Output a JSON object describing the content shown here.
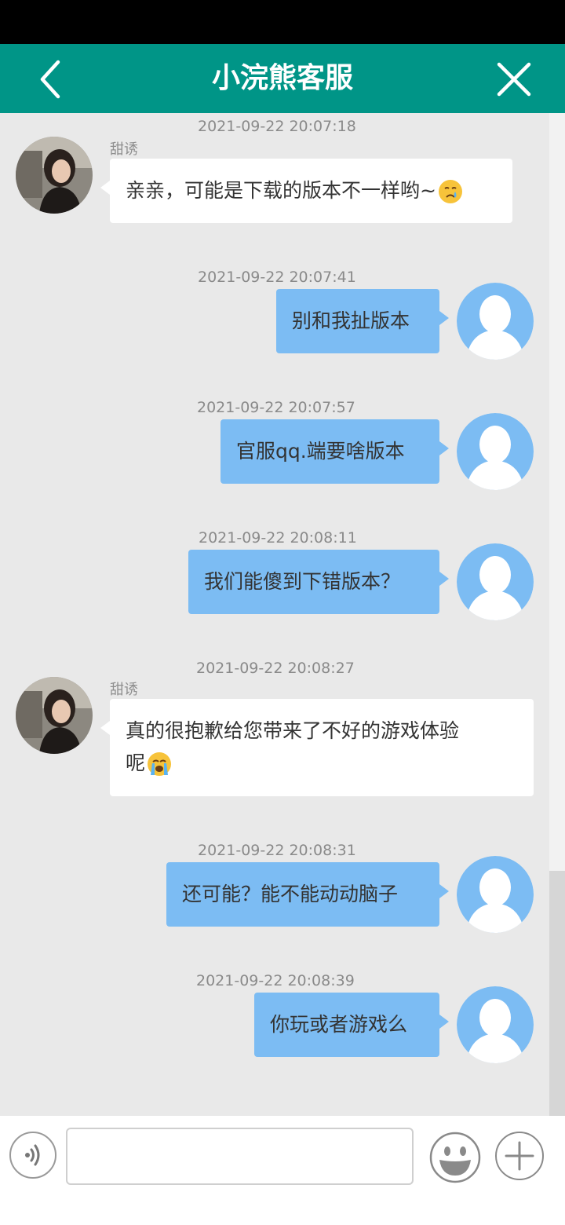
{
  "header": {
    "title": "小浣熊客服",
    "back_icon": "chevron-left-icon",
    "close_icon": "close-icon",
    "bg_color": "#009587"
  },
  "messages": [
    {
      "direction": "in",
      "sender": "甜诱",
      "time": "2021-09-22 20:07:18",
      "text": "亲亲，可能是下载的版本不一样哟~",
      "emoji": "crying-face-icon"
    },
    {
      "direction": "out",
      "time": "2021-09-22 20:07:41",
      "text": "别和我扯版本"
    },
    {
      "direction": "out",
      "time": "2021-09-22 20:07:57",
      "text": "官服qq.端要啥版本"
    },
    {
      "direction": "out",
      "time": "2021-09-22 20:08:11",
      "text": "我们能傻到下错版本？"
    },
    {
      "direction": "in",
      "sender": "甜诱",
      "time": "2021-09-22 20:08:27",
      "text_line1": "真的很抱歉给您带来了不好的游戏体验",
      "text_line2": "呢",
      "emoji": "loudly-crying-face-icon"
    },
    {
      "direction": "out",
      "time": "2021-09-22 20:08:31",
      "text": "还可能？能不能动动脑子"
    },
    {
      "direction": "out",
      "time": "2021-09-22 20:08:39",
      "text": "你玩或者游戏么"
    }
  ],
  "input_bar": {
    "placeholder": "",
    "voice_icon": "voice-icon",
    "emoji_icon": "smiley-icon",
    "plus_icon": "plus-icon"
  },
  "colors": {
    "outgoing_bubble": "#7cbcf3",
    "incoming_bubble": "#ffffff",
    "chat_bg": "#e9e9e9"
  }
}
